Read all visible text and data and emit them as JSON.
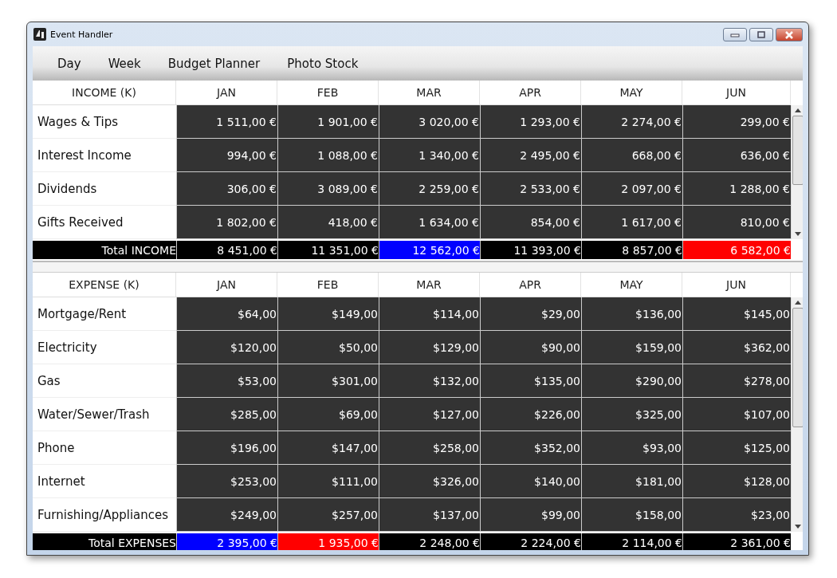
{
  "window": {
    "title": "Event Handler"
  },
  "menu": [
    "Day",
    "Week",
    "Budget Planner",
    "Photo Stock"
  ],
  "tables": [
    {
      "heading": "INCOME (K)",
      "columns": [
        "JAN",
        "FEB",
        "MAR",
        "APR",
        "MAY",
        "JUN"
      ],
      "rows": [
        {
          "label": "Wages & Tips",
          "values": [
            "1 511,00 €",
            "1 901,00 €",
            "3 020,00 €",
            "1 293,00 €",
            "2 274,00 €",
            "299,00 €"
          ]
        },
        {
          "label": "Interest Income",
          "values": [
            "994,00 €",
            "1 088,00 €",
            "1 340,00 €",
            "2 495,00 €",
            "668,00 €",
            "636,00 €"
          ]
        },
        {
          "label": "Dividends",
          "values": [
            "306,00 €",
            "3 089,00 €",
            "2 259,00 €",
            "2 533,00 €",
            "2 097,00 €",
            "1 288,00 €"
          ]
        },
        {
          "label": "Gifts Received",
          "values": [
            "1 802,00 €",
            "418,00 €",
            "1 634,00 €",
            "854,00 €",
            "1 617,00 €",
            "810,00 €"
          ]
        }
      ],
      "total": {
        "label": "Total INCOME",
        "cells": [
          {
            "value": "8 451,00 €",
            "color": "#000000"
          },
          {
            "value": "11 351,00 €",
            "color": "#000000"
          },
          {
            "value": "12 562,00 €",
            "color": "#0000ff"
          },
          {
            "value": "11 393,00 €",
            "color": "#000000"
          },
          {
            "value": "8 857,00 €",
            "color": "#000000"
          },
          {
            "value": "6 582,00 €",
            "color": "#ff0000"
          }
        ]
      }
    },
    {
      "heading": "EXPENSE (K)",
      "columns": [
        "JAN",
        "FEB",
        "MAR",
        "APR",
        "MAY",
        "JUN"
      ],
      "rows": [
        {
          "label": "Mortgage/Rent",
          "values": [
            "$64,00",
            "$149,00",
            "$114,00",
            "$29,00",
            "$136,00",
            "$145,00"
          ]
        },
        {
          "label": "Electricity",
          "values": [
            "$120,00",
            "$50,00",
            "$129,00",
            "$90,00",
            "$159,00",
            "$362,00"
          ]
        },
        {
          "label": "Gas",
          "values": [
            "$53,00",
            "$301,00",
            "$132,00",
            "$135,00",
            "$290,00",
            "$278,00"
          ]
        },
        {
          "label": "Water/Sewer/Trash",
          "values": [
            "$285,00",
            "$69,00",
            "$127,00",
            "$226,00",
            "$325,00",
            "$107,00"
          ]
        },
        {
          "label": "Phone",
          "values": [
            "$196,00",
            "$147,00",
            "$258,00",
            "$352,00",
            "$93,00",
            "$125,00"
          ]
        },
        {
          "label": "Internet",
          "values": [
            "$253,00",
            "$111,00",
            "$326,00",
            "$140,00",
            "$181,00",
            "$128,00"
          ]
        },
        {
          "label": "Furnishing/Appliances",
          "values": [
            "$249,00",
            "$257,00",
            "$137,00",
            "$99,00",
            "$158,00",
            "$23,00"
          ]
        }
      ],
      "total": {
        "label": "Total EXPENSES",
        "cells": [
          {
            "value": "2 395,00 €",
            "color": "#0000ff"
          },
          {
            "value": "1 935,00 €",
            "color": "#ff0000"
          },
          {
            "value": "2 248,00 €",
            "color": "#000000"
          },
          {
            "value": "2 224,00 €",
            "color": "#000000"
          },
          {
            "value": "2 114,00 €",
            "color": "#000000"
          },
          {
            "value": "2 361,00 €",
            "color": "#000000"
          }
        ]
      }
    }
  ]
}
